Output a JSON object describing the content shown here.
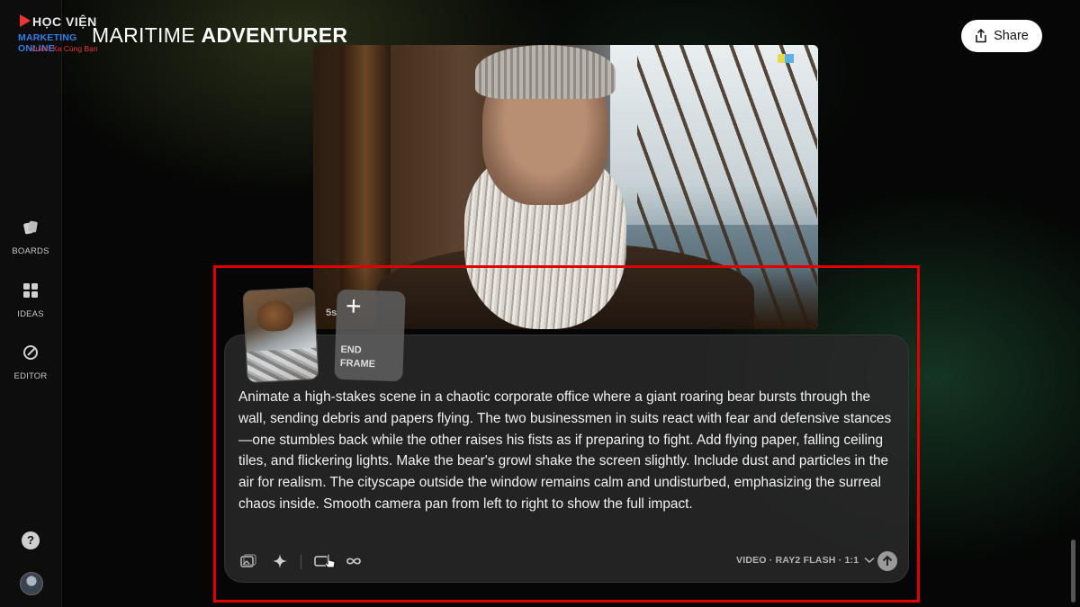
{
  "logo": {
    "line1": "HỌC VIỆN",
    "line2": "MARKETING ONLINE",
    "line3": "Vươn Xa Cùng Bạn"
  },
  "header": {
    "title_light": "MARITIME ",
    "title_bold": "ADVENTURER",
    "share_label": "Share"
  },
  "sidebar": {
    "items": [
      {
        "label": "BOARDS",
        "icon": "boards-icon"
      },
      {
        "label": "IDEAS",
        "icon": "ideas-icon"
      },
      {
        "label": "EDITOR",
        "icon": "editor-icon"
      }
    ],
    "help_label": "?"
  },
  "composer": {
    "duration": "5s",
    "end_frame_line1": "END",
    "end_frame_line2": "FRAME",
    "prompt_text": "Animate a high-stakes scene in a chaotic corporate office where a giant roaring bear bursts through the wall, sending debris and papers flying. The two businessmen in suits react with fear and defensive stances—one stumbles back while the other raises his fists as if preparing to fight. Add flying paper, falling ceiling tiles, and flickering lights. Make the bear's growl shake the screen slightly. Include dust and particles in the air for realism. The cityscape outside the window remains calm and undisturbed, emphasizing the surreal chaos inside. Smooth camera pan from left to right to show the full impact.",
    "model_label": "VIDEO · RAY2 FLASH · 1:1",
    "tools": [
      "image-reference-icon",
      "sparkle-icon",
      "frame-mode-icon",
      "loop-icon"
    ]
  },
  "colors": {
    "highlight_border": "#e00000",
    "panel_bg": "#282828",
    "share_bg": "#ffffff"
  }
}
